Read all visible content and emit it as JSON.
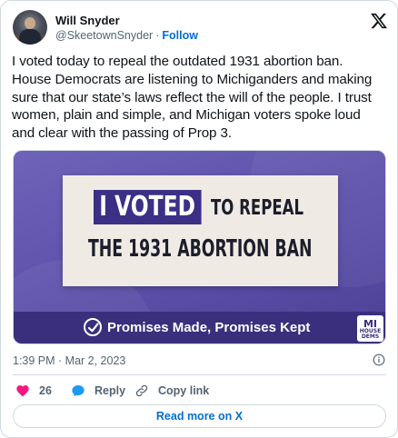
{
  "author": {
    "name": "Will Snyder",
    "handle": "@SkeetownSnyder",
    "separator": "·",
    "follow_label": "Follow"
  },
  "tweet": {
    "text": "I voted today to repeal the outdated 1931 abortion ban. House Democrats are listening to Michiganders and making sure that our state’s laws reflect the will of the people. I trust women, plain and simple, and Michigan voters spoke loud and clear with the passing of Prop 3."
  },
  "media": {
    "voted_text": "I VOTED",
    "repeal_text": "TO REPEAL",
    "ban_text": "THE 1931 ABORTION BAN",
    "slogan": "Promises Made, Promises Kept",
    "logo_text": [
      "MI",
      "HOUSE",
      "DEMS"
    ],
    "colors": {
      "background": "#5b4fa8",
      "banner": "#3a2f7c",
      "voted_box": "#3b2f86",
      "sign": "#efebe4"
    }
  },
  "meta": {
    "timestamp": "1:39 PM · Mar 2, 2023"
  },
  "actions": {
    "likes_count": "26",
    "reply_label": "Reply",
    "copy_label": "Copy link"
  },
  "footer": {
    "read_more_label": "Read more on X"
  },
  "icons": [
    "x-logo-icon",
    "heart-icon",
    "reply-icon",
    "link-icon",
    "info-icon",
    "check-circle-icon"
  ]
}
